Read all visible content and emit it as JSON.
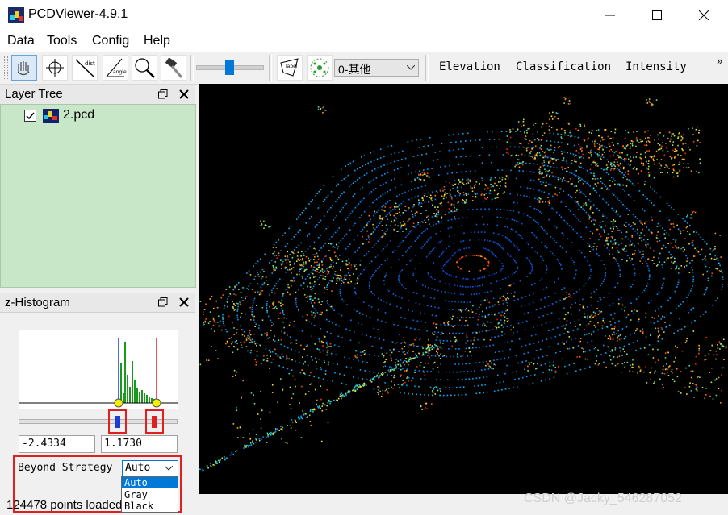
{
  "window": {
    "title": "PCDViewer-4.9.1",
    "minimize_icon": "minimize-icon",
    "maximize_icon": "maximize-icon",
    "close_icon": "close-icon"
  },
  "menu": [
    "Data",
    "Tools",
    "Config",
    "Help"
  ],
  "toolbar": {
    "tool_icons": [
      "hand-pan-icon",
      "crosshair-icon",
      "distance-icon",
      "angle-icon",
      "zoom-icon",
      "hammer-icon"
    ],
    "distance_label": "dist",
    "angle_label": "angle",
    "label_tool_label": "label",
    "point_size_slider_value": 0.5,
    "class_select": "0-其他",
    "overflow": "»",
    "color_modes": [
      "Elevation",
      "Classification",
      "Intensity"
    ]
  },
  "layer_tree": {
    "title": "Layer Tree",
    "items": [
      {
        "label": "2.pcd",
        "checked": true
      }
    ]
  },
  "histogram": {
    "title": "z-Histogram",
    "min_value": "-2.4334",
    "max_value": "1.1730",
    "beyond_strategy_label": "Beyond Strategy",
    "beyond_strategy_value": "Auto",
    "beyond_strategy_options": [
      "Auto",
      "Gray",
      "Black"
    ]
  },
  "status": "124478 points loaded",
  "watermark": "CSDN @Jacky_546287052",
  "colors": {
    "viewer_bg": "#000000",
    "layer_tree_bg": "#c8e6c8",
    "min_marker": "#1e3cd0",
    "max_marker": "#e02020",
    "highlight": "#e02020"
  }
}
